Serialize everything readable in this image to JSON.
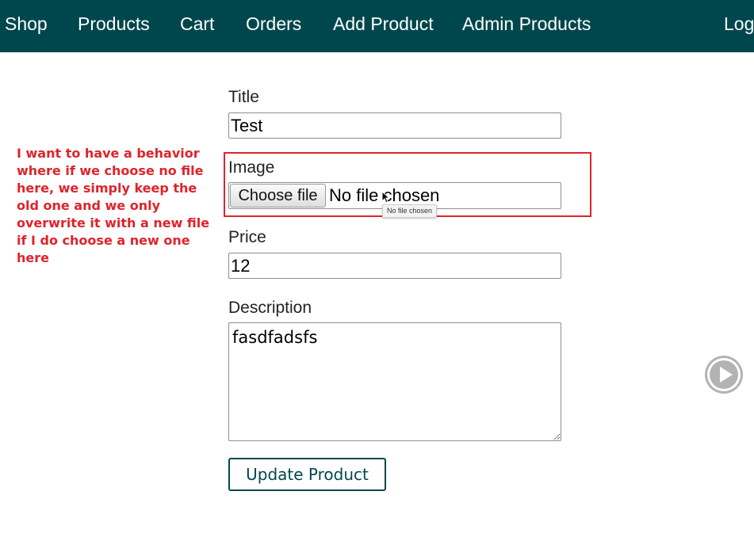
{
  "nav": {
    "items": [
      "Shop",
      "Products",
      "Cart",
      "Orders",
      "Add Product",
      "Admin Products",
      "Logout"
    ]
  },
  "annotation": {
    "text": "I want to have a behavior where if we choose no file here, we simply keep the old one and we only overwrite it with a new file if I do choose a new one here"
  },
  "form": {
    "title_label": "Title",
    "title_value": "Test",
    "image_label": "Image",
    "choose_file_label": "Choose file",
    "file_status": "No file chosen",
    "file_tooltip": "No file chosen",
    "price_label": "Price",
    "price_value": "12",
    "description_label": "Description",
    "description_value": "fasdfadsfs",
    "submit_label": "Update Product"
  },
  "icons": {
    "play": "play-icon",
    "cursor": "mouse-pointer-icon"
  },
  "colors": {
    "nav_background": "#00474d",
    "annotation": "#e0232b",
    "button_accent": "#00474d"
  }
}
